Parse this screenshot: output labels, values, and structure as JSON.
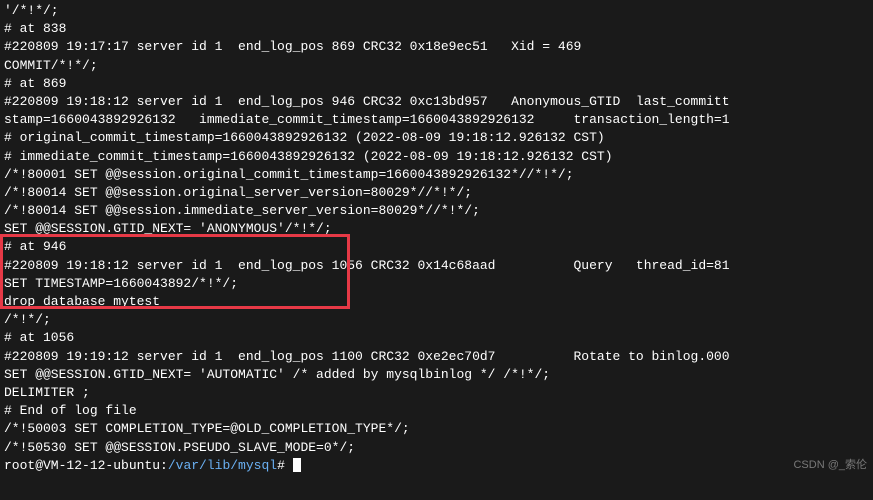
{
  "lines": [
    "'/*!*/;",
    "# at 838",
    "#220809 19:17:17 server id 1  end_log_pos 869 CRC32 0x18e9ec51   Xid = 469",
    "COMMIT/*!*/;",
    "# at 869",
    "#220809 19:18:12 server id 1  end_log_pos 946 CRC32 0xc13bd957   Anonymous_GTID  last_committ",
    "stamp=1660043892926132   immediate_commit_timestamp=1660043892926132     transaction_length=1",
    "# original_commit_timestamp=1660043892926132 (2022-08-09 19:18:12.926132 CST)",
    "# immediate_commit_timestamp=1660043892926132 (2022-08-09 19:18:12.926132 CST)",
    "/*!80001 SET @@session.original_commit_timestamp=1660043892926132*//*!*/;",
    "/*!80014 SET @@session.original_server_version=80029*//*!*/;",
    "/*!80014 SET @@session.immediate_server_version=80029*//*!*/;",
    "SET @@SESSION.GTID_NEXT= 'ANONYMOUS'/*!*/;",
    "# at 946",
    "#220809 19:18:12 server id 1  end_log_pos 1056 CRC32 0x14c68aad          Query   thread_id=81",
    "SET TIMESTAMP=1660043892/*!*/;",
    "drop database mytest",
    "/*!*/;",
    "# at 1056",
    "#220809 19:19:12 server id 1  end_log_pos 1100 CRC32 0xe2ec70d7          Rotate to binlog.000",
    "SET @@SESSION.GTID_NEXT= 'AUTOMATIC' /* added by mysqlbinlog */ /*!*/;",
    "DELIMITER ;",
    "# End of log file",
    "/*!50003 SET COMPLETION_TYPE=@OLD_COMPLETION_TYPE*/;",
    "/*!50530 SET @@SESSION.PSEUDO_SLAVE_MODE=0*/;"
  ],
  "prompt": {
    "user_host": "root@VM-12-12-ubuntu",
    "separator": ":",
    "path": "/var/lib/mysql",
    "suffix": "#"
  },
  "watermark": "CSDN @_索伦"
}
